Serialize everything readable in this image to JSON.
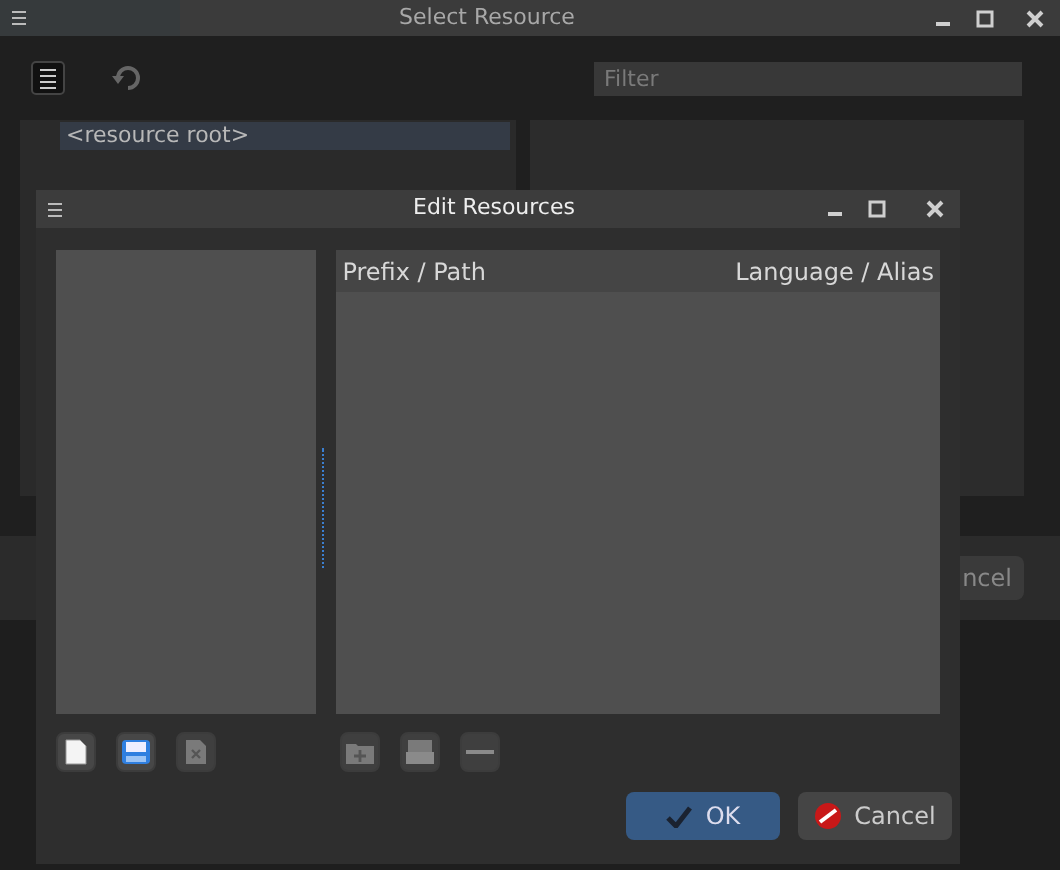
{
  "main_window": {
    "title": "Select Resource",
    "filter": {
      "placeholder": "Filter"
    },
    "tree": [
      {
        "label": "<resource root>",
        "selected": true
      }
    ],
    "cancel_button_partial": "ncel"
  },
  "dialog": {
    "title": "Edit Resources",
    "table": {
      "columns": [
        "Prefix / Path",
        "Language / Alias"
      ]
    },
    "file_buttons": [
      {
        "kind": "new",
        "disabled": false
      },
      {
        "kind": "save",
        "disabled": false
      },
      {
        "kind": "remove",
        "disabled": true
      }
    ],
    "prefix_buttons": [
      {
        "kind": "add-folder",
        "disabled": true
      },
      {
        "kind": "files",
        "disabled": true
      },
      {
        "kind": "minus",
        "disabled": true
      }
    ],
    "ok": "OK",
    "cancel": "Cancel"
  }
}
